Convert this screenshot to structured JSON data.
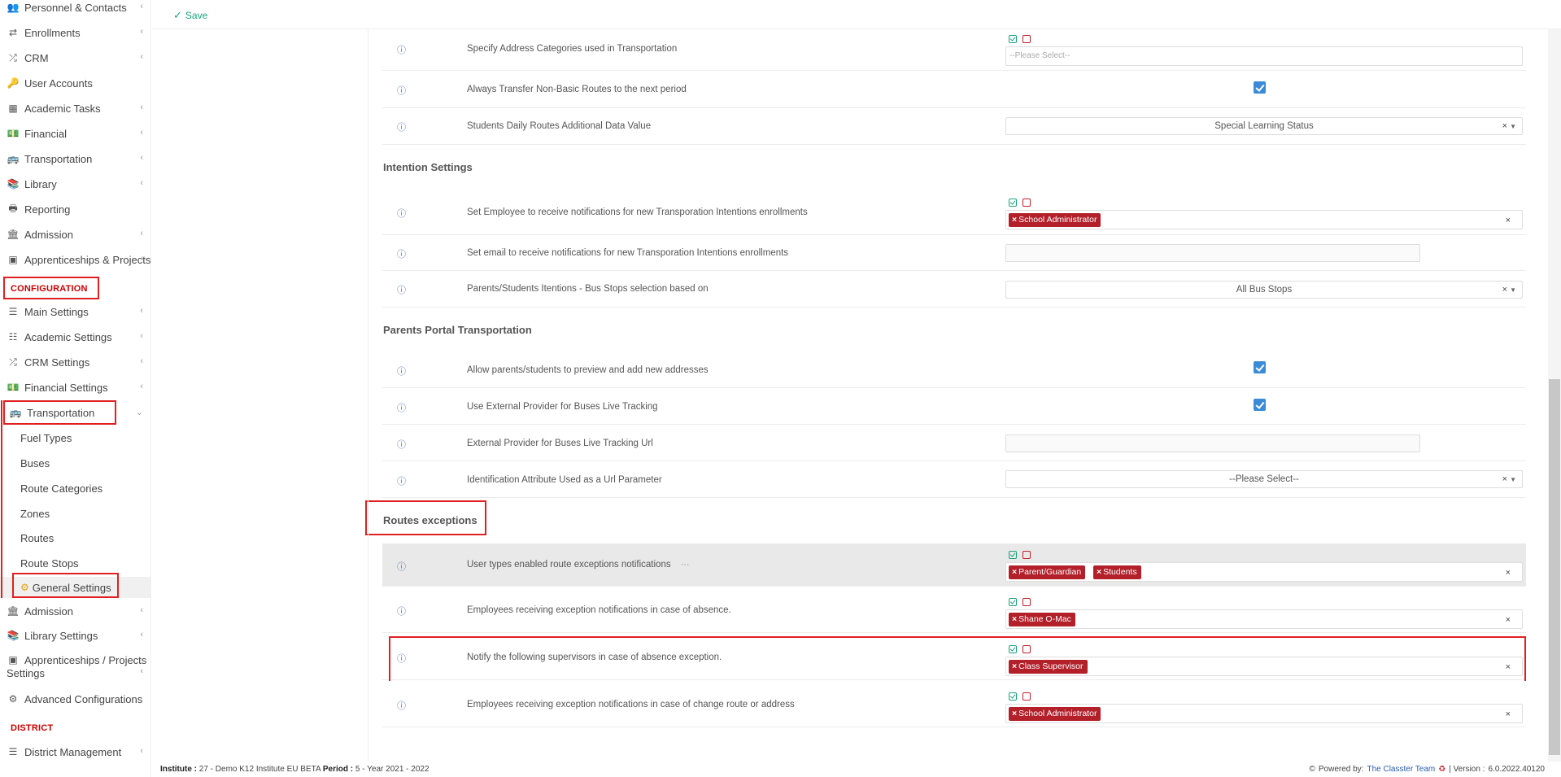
{
  "topbar": {
    "save_label": "Save"
  },
  "sidebar": {
    "items": [
      {
        "label": "Personnel & Contacts",
        "icon": "contacts-icon"
      },
      {
        "label": "Enrollments",
        "icon": "exchange-icon"
      },
      {
        "label": "CRM",
        "icon": "crm-icon"
      },
      {
        "label": "User Accounts",
        "icon": "key-icon"
      },
      {
        "label": "Academic Tasks",
        "icon": "grid-icon"
      },
      {
        "label": "Financial",
        "icon": "money-icon"
      },
      {
        "label": "Transportation",
        "icon": "bus-icon"
      },
      {
        "label": "Library",
        "icon": "books-icon"
      },
      {
        "label": "Reporting",
        "icon": "printer-icon"
      },
      {
        "label": "Admission",
        "icon": "institution-icon"
      },
      {
        "label": "Apprenticeships & Projects",
        "icon": "cube-icon"
      }
    ],
    "config_section": "CONFIGURATION",
    "config_items": [
      {
        "label": "Main Settings",
        "icon": "sliders-icon"
      },
      {
        "label": "Academic Settings",
        "icon": "hierarchy-icon"
      },
      {
        "label": "CRM Settings",
        "icon": "crm-icon"
      },
      {
        "label": "Financial Settings",
        "icon": "money-icon"
      },
      {
        "label": "Transportation",
        "icon": "bus-icon"
      }
    ],
    "transport_sub": [
      "Fuel Types",
      "Buses",
      "Route Categories",
      "Zones",
      "Routes",
      "Route Stops",
      "General Settings"
    ],
    "config_items2": [
      {
        "label": "Admission",
        "icon": "institution-icon"
      },
      {
        "label": "Library Settings",
        "icon": "books-icon"
      },
      {
        "label": "Apprenticeships / Projects",
        "label2": "Settings",
        "icon": "cube-icon"
      },
      {
        "label": "Advanced Configurations",
        "icon": "gears-icon"
      }
    ],
    "district_section": "DISTRICT",
    "district_items": [
      {
        "label": "District Management",
        "icon": "list-icon"
      }
    ]
  },
  "rows": {
    "address_categories": {
      "label": "Specify Address Categories used in Transportation",
      "placeholder": "--Please Select--"
    },
    "transfer_non_basic": {
      "label": "Always Transfer Non-Basic Routes to the next period",
      "checked": true
    },
    "daily_routes_additional": {
      "label": "Students Daily Routes Additional Data Value",
      "value": "Special Learning Status"
    },
    "intention_title": "Intention Settings",
    "intention_employee": {
      "label": "Set Employee to receive notifications for new Transporation Intentions enrollments",
      "tags": [
        "School Administrator"
      ]
    },
    "intention_email": {
      "label": "Set email to receive notifications for new Transporation Intentions enrollments"
    },
    "intention_bus_stops": {
      "label": "Parents/Students Itentions - Bus Stops selection based on",
      "value": "All Bus Stops"
    },
    "parents_title": "Parents Portal Transportation",
    "allow_addresses": {
      "label": "Allow parents/students to preview and add new addresses",
      "checked": true
    },
    "external_provider": {
      "label": "Use External Provider for Buses Live Tracking",
      "checked": true
    },
    "external_url": {
      "label": "External Provider for Buses Live Tracking Url"
    },
    "identification_attr": {
      "label": "Identification Attribute Used as a Url Parameter",
      "value": "--Please Select--"
    },
    "routes_exc_title": "Routes exceptions",
    "user_types": {
      "label": "User types enabled route exceptions notifications",
      "ellipsis": "···",
      "tags": [
        "Parent/Guardian",
        "Students"
      ]
    },
    "absence_employees": {
      "label": "Employees receiving exception notifications in case of absence.",
      "tags": [
        "Shane O-Mac"
      ]
    },
    "absence_supervisors": {
      "label": "Notify the following supervisors in case of absence exception.",
      "tags": [
        "Class Supervisor"
      ]
    },
    "change_route": {
      "label": "Employees receiving exception notifications in case of change route or address",
      "tags": [
        "School Administrator"
      ]
    }
  },
  "footer": {
    "institute_label": "Institute :",
    "institute_value": "27 - Demo K12 Institute EU BETA",
    "period_label": "Period :",
    "period_value": "5 - Year 2021 - 2022",
    "powered_by": "Powered by:",
    "team": "The Classter Team",
    "version_label": "| Version :",
    "version_value": "6.0.2022.40120"
  },
  "colors": {
    "accent_green": "#1aa37a",
    "tag_red": "#b3202a",
    "highlight_red": "#e02020",
    "info_blue": "#4a6fb5"
  }
}
